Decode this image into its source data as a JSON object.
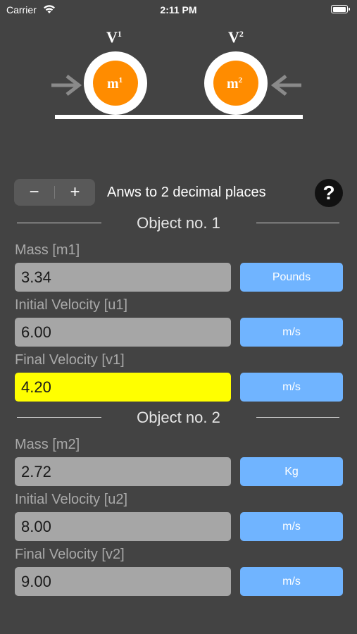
{
  "status_bar": {
    "carrier": "Carrier",
    "time": "2:11 PM",
    "battery_level": 1.0
  },
  "diagram": {
    "v1_label": "V",
    "v1_sup": "1",
    "v2_label": "V",
    "v2_sup": "2",
    "m1_label": "m",
    "m1_sup": "1",
    "m2_label": "m",
    "m2_sup": "2",
    "ball_color": "#FF8C00",
    "ring_color": "#FFFFFF",
    "arrow_color": "#8A8A8A"
  },
  "toolbar": {
    "minus_label": "−",
    "plus_label": "+",
    "decimal_text": "Anws to 2 decimal places",
    "help_label": "?"
  },
  "object1": {
    "title": "Object no. 1",
    "mass": {
      "label": "Mass [m1]",
      "value": "3.34",
      "unit": "Pounds"
    },
    "initial_velocity": {
      "label": "Initial Velocity [u1]",
      "value": "6.00",
      "unit": "m/s"
    },
    "final_velocity": {
      "label": "Final Velocity [v1]",
      "value": "4.20",
      "unit": "m/s"
    }
  },
  "object2": {
    "title": "Object no. 2",
    "mass": {
      "label": "Mass [m2]",
      "value": "2.72",
      "unit": "Kg"
    },
    "initial_velocity": {
      "label": "Initial Velocity [u2]",
      "value": "8.00",
      "unit": "m/s"
    },
    "final_velocity": {
      "label": "Final Velocity [v2]",
      "value": "9.00",
      "unit": "m/s"
    }
  },
  "colors": {
    "background": "#434343",
    "unit_button": "#70B4FF",
    "input_box": "#A6A6A6",
    "highlight": "#FFFF00"
  }
}
